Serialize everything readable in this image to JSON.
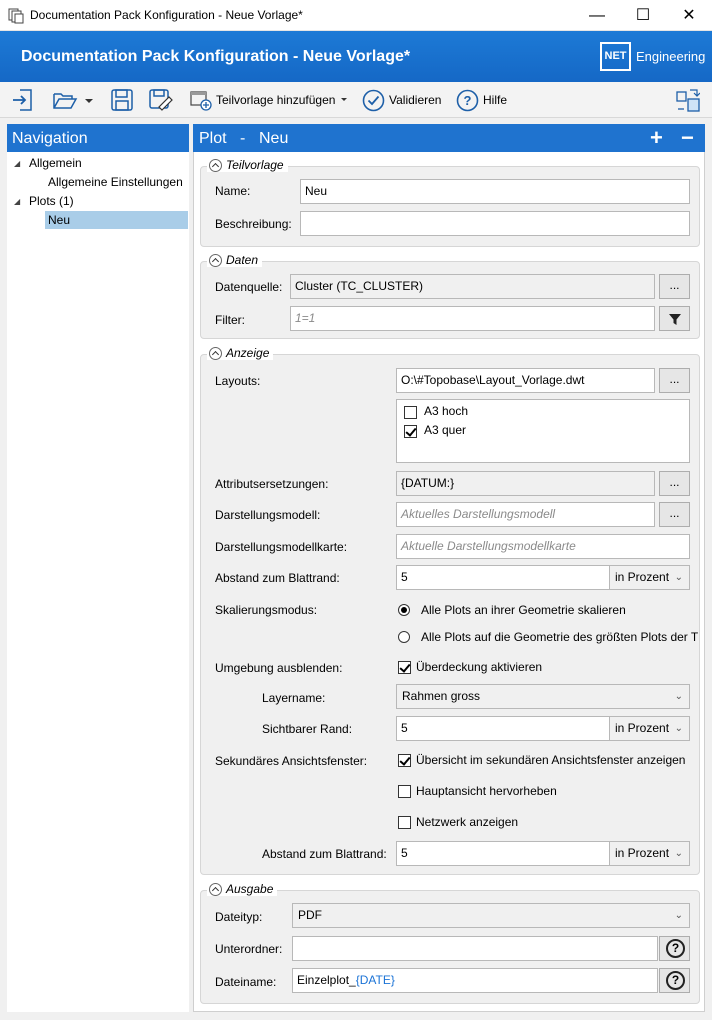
{
  "window": {
    "title": "Documentation Pack Konfiguration - Neue Vorlage*",
    "controls": {
      "minimize": "—",
      "maximize": "☐",
      "close": "✕"
    }
  },
  "banner": {
    "title": "Documentation Pack Konfiguration - Neue Vorlage*",
    "logo_box": "NET",
    "logo_text": "Engineering"
  },
  "toolbar": {
    "add_subtemplate_label": "Teilvorlage hinzufügen",
    "validate_label": "Validieren",
    "help_label": "Hilfe"
  },
  "navigation": {
    "title": "Navigation",
    "items": [
      {
        "label": "Allgemein"
      },
      {
        "label": "Allgemeine Einstellungen"
      },
      {
        "label": "Plots (1)"
      },
      {
        "label": "Neu"
      }
    ]
  },
  "main": {
    "header_section": "Plot",
    "header_sep": "-",
    "header_name": "Neu",
    "add_icon": "+",
    "remove_icon": "−",
    "teilvorlage": {
      "title": "Teilvorlage",
      "name_label": "Name:",
      "name_value": "Neu",
      "desc_label": "Beschreibung:",
      "desc_value": ""
    },
    "daten": {
      "title": "Daten",
      "source_label": "Datenquelle:",
      "source_value": "Cluster (TC_CLUSTER)",
      "browse_label": "...",
      "filter_label": "Filter:",
      "filter_placeholder": "1=1"
    },
    "anzeige": {
      "title": "Anzeige",
      "layouts_label": "Layouts:",
      "layouts_value": "O:\\#Topobase\\Layout_Vorlage.dwt",
      "browse_label": "...",
      "layout_items": [
        {
          "label": "A3 hoch",
          "checked": false
        },
        {
          "label": "A3 quer",
          "checked": true
        }
      ],
      "attr_label": "Attributsersetzungen:",
      "attr_value": "{DATUM:}",
      "model_label": "Darstellungsmodell:",
      "model_placeholder": "Aktuelles Darstellungsmodell",
      "modelmap_label": "Darstellungsmodellkarte:",
      "modelmap_placeholder": "Aktuelle Darstellungsmodellkarte",
      "margin_label": "Abstand zum Blattrand:",
      "margin_value": "5",
      "unit_value": "in Prozent",
      "scale_label": "Skalierungsmodus:",
      "scale_option1": "Alle Plots an ihrer Geometrie skalieren",
      "scale_option2": "Alle Plots auf die Geometrie des größten Plots der T",
      "scale_selected": 1,
      "env_label": "Umgebung ausblenden:",
      "env_check_label": "Überdeckung aktivieren",
      "env_checked": true,
      "layer_label": "Layername:",
      "layer_value": "Rahmen gross",
      "border_label": "Sichtbarer Rand:",
      "border_value": "5",
      "border_unit": "in Prozent",
      "secondary_label": "Sekundäres Ansichtsfenster:",
      "secondary_opt1": "Übersicht im sekundären Ansichtsfenster anzeigen",
      "secondary_opt1_checked": true,
      "secondary_opt2": "Hauptansicht hervorheben",
      "secondary_opt2_checked": false,
      "secondary_opt3": "Netzwerk anzeigen",
      "secondary_opt3_checked": false,
      "margin2_label": "Abstand zum Blattrand:",
      "margin2_value": "5",
      "margin2_unit": "in Prozent"
    },
    "ausgabe": {
      "title": "Ausgabe",
      "type_label": "Dateityp:",
      "type_value": "PDF",
      "subfolder_label": "Unterordner:",
      "subfolder_value": "",
      "filename_label": "Dateiname:",
      "filename_prefix": "Einzelplot_",
      "filename_token": "{DATE}",
      "help_glyph": "?"
    }
  },
  "colors": {
    "accent": "#1f73cf",
    "selection": "#a9cde8",
    "token": "#1b73d6"
  }
}
